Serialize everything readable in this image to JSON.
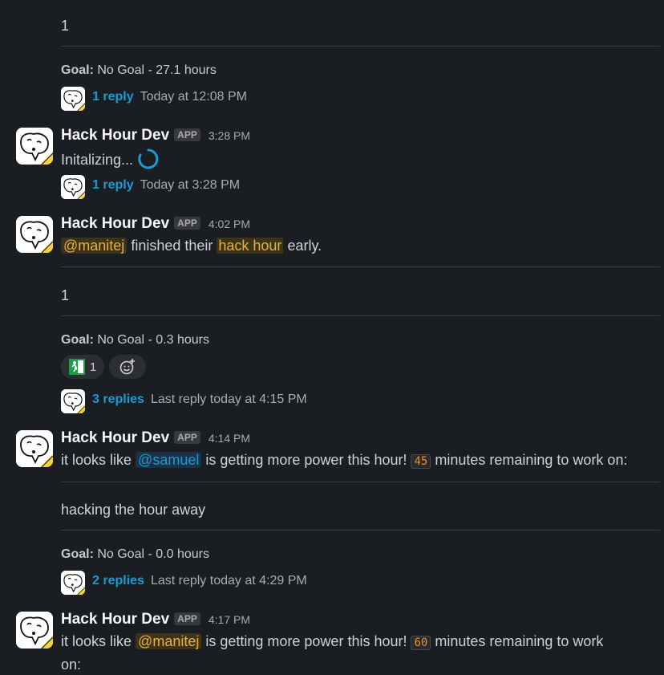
{
  "top": {
    "number1": "1",
    "goal1_label": "Goal:",
    "goal1_value": " No Goal - 27.1 hours",
    "thread1": {
      "link": "1 reply",
      "meta": "Today at 12:08 PM"
    }
  },
  "msg1": {
    "name": "Hack Hour Dev",
    "badge": "APP",
    "time": "3:28 PM",
    "text": "Initalizing...",
    "thread": {
      "link": "1 reply",
      "meta": "Today at 3:28 PM"
    }
  },
  "msg2": {
    "name": "Hack Hour Dev",
    "badge": "APP",
    "time": "4:02 PM",
    "mention": "@manitej",
    "text_mid": " finished their ",
    "highlight": "hack hour",
    "text_end": " early.",
    "number": "1",
    "goal_label": "Goal:",
    "goal_value": " No Goal - 0.3 hours",
    "reaction_count": "1",
    "thread": {
      "link": "3 replies",
      "meta": "Last reply today at 4:15 PM"
    }
  },
  "msg3": {
    "name": "Hack Hour Dev",
    "badge": "APP",
    "time": "4:14 PM",
    "text_start": "it looks like ",
    "mention": "@samuel",
    "text_mid": " is getting more power this hour! ",
    "minutes": "45",
    "text_end": " minutes remaining to work on:",
    "task": "hacking the hour away",
    "goal_label": "Goal:",
    "goal_value": " No Goal - 0.0 hours",
    "thread": {
      "link": "2 replies",
      "meta": "Last reply today at 4:29 PM"
    }
  },
  "msg4": {
    "name": "Hack Hour Dev",
    "badge": "APP",
    "time": "4:17 PM",
    "text_start": "it looks like ",
    "mention": "@manitej",
    "text_mid": " is getting more power this hour! ",
    "minutes": "60",
    "text_end": " minutes remaining to work",
    "text_wrap": "on:"
  },
  "icons": {
    "avatar": "hack-hour-dino-avatar",
    "loading": "loading-spinner",
    "exit_emoji": "emergency-exit-icon",
    "add_reaction": "add-reaction-icon"
  },
  "colors": {
    "background": "#1a1d21",
    "link": "#1d9bd1",
    "mention_bg": "#3d3319",
    "mention_fg": "#e8b13f"
  }
}
